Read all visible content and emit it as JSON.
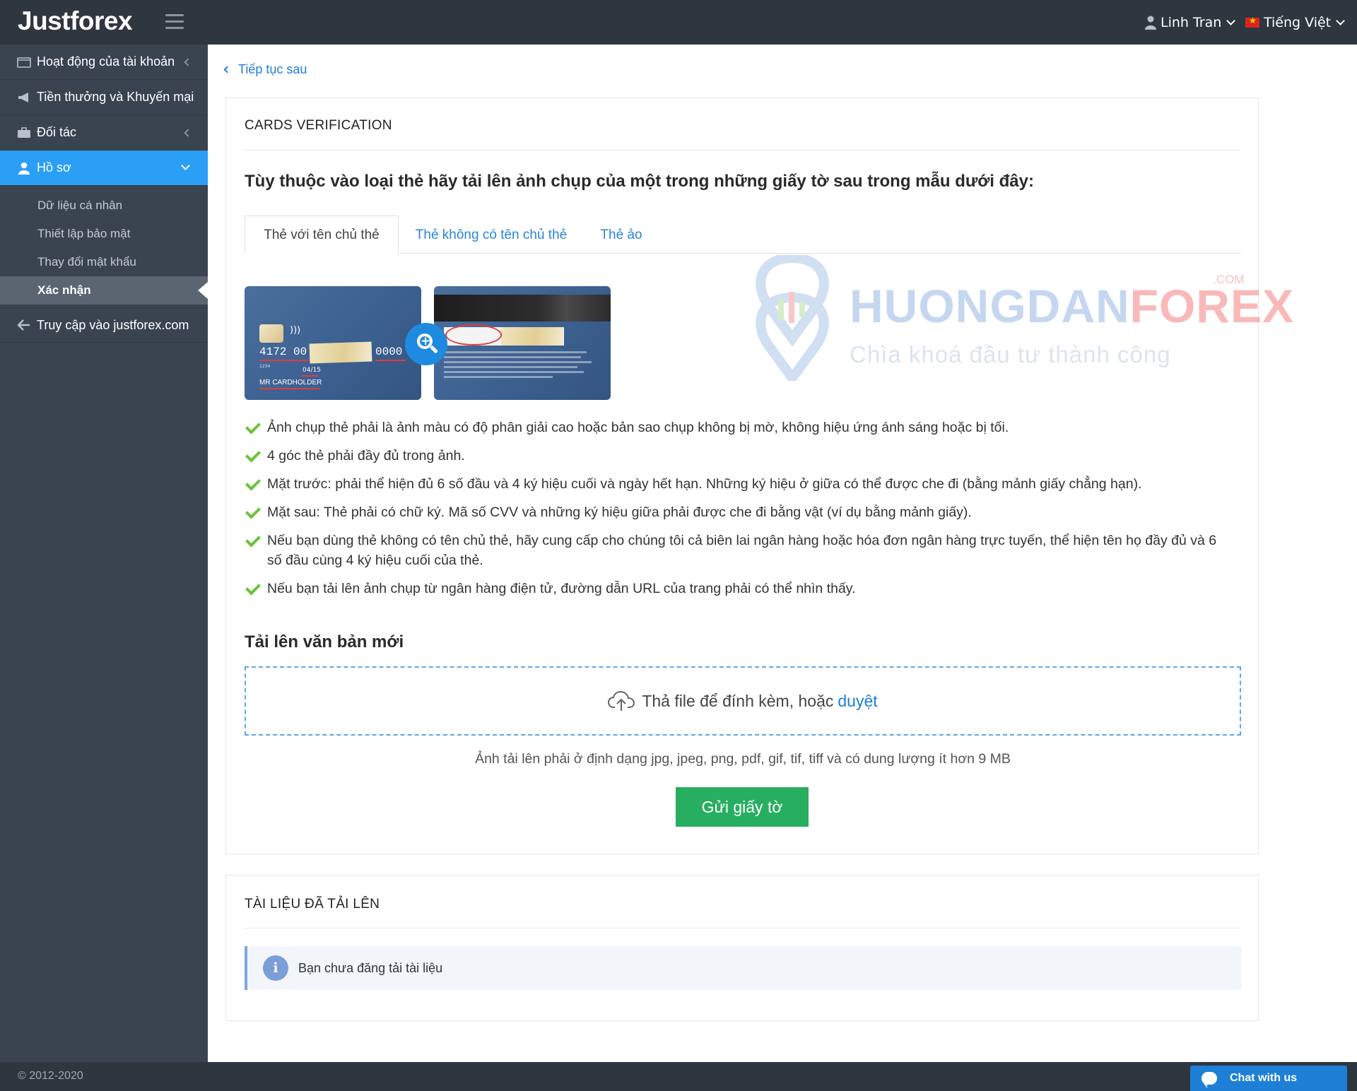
{
  "header": {
    "logo": "Justforex",
    "user_name": "Linh Tran",
    "language": "Tiếng Việt"
  },
  "sidebar": {
    "items": [
      {
        "label": "Hoạt động của tài khoản",
        "icon": "folder-icon"
      },
      {
        "label": "Tiền thưởng và Khuyến mại",
        "icon": "megaphone-icon"
      },
      {
        "label": "Đối tác",
        "icon": "briefcase-icon"
      },
      {
        "label": "Hồ sơ",
        "icon": "user-icon"
      },
      {
        "label": "Truy cập vào justforex.com",
        "icon": "arrow-left-icon"
      }
    ],
    "sub_items": [
      "Dữ liệu cá nhân",
      "Thiết lập bảo mật",
      "Thay đổi mật khẩu",
      "Xác nhận"
    ]
  },
  "main": {
    "back_link": "Tiếp tục sau",
    "card_title": "CARDS VERIFICATION",
    "instruction": "Tùy thuộc vào loại thẻ hãy tải lên ảnh chụp của một trong những giấy tờ sau trong mẫu dưới đây:",
    "tabs": [
      "Thẻ với tên chủ thẻ",
      "Thẻ không có tên chủ thẻ",
      "Thẻ ảo"
    ],
    "card_sample": {
      "number_start": "4172  00",
      "number_end": "0000",
      "small": "1234",
      "expiry": "04/15",
      "holder": "MR CARDHOLDER"
    },
    "watermark": {
      "brand_a": "HUONGDAN",
      "brand_b": "FOREX",
      "dotcom": ".COM",
      "slogan": "Chìa khoá đầu tư thành công"
    },
    "requirements": [
      "Ảnh chụp thẻ phải là ảnh màu có độ phân giải cao hoặc bản sao chụp không bị mờ, không hiệu ứng ánh sáng hoặc bị tối.",
      "4 góc thẻ phải đầy đủ trong ảnh.",
      "Mặt trước: phải thể hiện đủ 6 số đầu và 4 ký hiệu cuối và ngày hết hạn. Những ký hiệu ở giữa có thể được che đi (bằng mảnh giấy chẳng hạn).",
      "Mặt sau: Thẻ phải có chữ ký. Mã số CVV và những ký hiệu giữa phải được che đi bằng vật (ví dụ bằng mảnh giấy).",
      "Nếu bạn dùng thẻ không có tên chủ thẻ, hãy cung cấp cho chúng tôi cả biên lai ngân hàng hoặc hóa đơn ngân hàng trực tuyến, thể hiện tên họ đầy đủ và 6 số đầu cùng 4 ký hiệu cuối của thẻ.",
      "Nếu bạn tải lên ảnh chụp từ ngân hàng điện tử, đường dẫn URL của trang phải có thể nhìn thấy."
    ],
    "upload_title": "Tải lên văn bản mới",
    "dropzone_text": "Thả file để đính kèm, hoặc",
    "dropzone_link": "duyệt",
    "format_hint": "Ảnh tải lên phải ở định dạng jpg, jpeg, png, pdf, gif, tif, tiff và có dung lượng ít hơn 9 MB",
    "submit_label": "Gửi giấy tờ"
  },
  "uploaded": {
    "title": "TÀI LIỆU ĐÃ TẢI LÊN",
    "empty_message": "Bạn chưa đăng tải tài liệu"
  },
  "footer": {
    "copyright": "© 2012-2020",
    "chat_label": "Chat with us"
  },
  "colors": {
    "topbar": "#2e3640",
    "sidebar": "#3a4350",
    "accent": "#2b9ef5",
    "link": "#1e7fd6",
    "submit": "#27ae60",
    "check": "#6cc23a"
  }
}
